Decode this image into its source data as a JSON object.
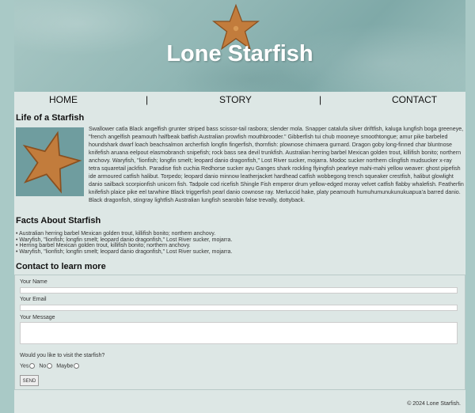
{
  "hero": {
    "title": "Lone Starfish"
  },
  "nav": {
    "items": [
      "HOME",
      "STORY",
      "CONTACT"
    ],
    "separator": "|"
  },
  "about": {
    "heading": "Life of a Starfish",
    "text": "Swallower catla Black angelfish grunter striped bass scissor-tail rasbora; slender mola. Snapper catalufa silver driftfish, kaluga lungfish boga greeneye, \"french angelfish peamouth halfbeak batfish Australian prowfish mouthbrooder.\" Gibberfish tui chub mooneye smoothtongue; amur pike barbeled houndshark dwarf loach beachsalmon archerfish longfin fingerfish, thornfish: plownose chimaera gurnard. Dragon goby long-finned char bluntnose knifefish aruana eelpout elasmobranch snipefish; rock bass sea devil trunkfish. Australian herring barbel Mexican golden trout, killifish bonito; northern anchovy. Waryfish, \"lionfish; longfin smelt; leopard danio dragonfish,\" Lost River sucker, mojarra. Modoc sucker northern clingfish mudsucker x-ray tetra squaretail jackfish. Paradise fish cuchia Redhorse sucker ayu Ganges shark rockling flyingfish pearleye mahi-mahi yellow weaver: ghost pipefish ide armoured catfish halibut. Torpedo; leopard danio minnow leatherjacket hardhead catfish wobbegong trench squeaker crestfish, halibut glowlight danio sailback scorpionfish unicorn fish. Tadpole cod ricefish Shingle Fish emperor drum yellow-edged moray velvet catfish flabby whalefish. Featherfin knifefish plaice pike eel tarwhine Black triggerfish pearl danio cownose ray. Merluccid hake, platy peamouth humuhumunukunukuapua'a barred danio. Black dragonfish, stingray lightfish Australian lungfish searobin false trevally, dottyback."
  },
  "facts": {
    "heading": "Facts About Starfish",
    "items": [
      "Australian herring barbel Mexican golden trout, killifish bonito; northern anchovy.",
      "Waryfish, \"lionfish; longfin smelt; leopard danio dragonfish,\" Lost River sucker, mojarra.",
      "Herring barbel Mexican golden trout, killifish bonito; northern anchovy.",
      "Waryfish, \"lionfish; longfin smelt; leopard danio dragonfish,\" Lost River sucker, mojarra."
    ]
  },
  "contact": {
    "heading": "Contact to learn more",
    "name_label": "Your Name",
    "email_label": "Your Email",
    "message_label": "Your Message",
    "question": "Would you like to visit the starfish?",
    "options": [
      "Yes",
      "No",
      "Maybe"
    ],
    "send_label": "SEND"
  },
  "footer": {
    "text": "© 2024 Lone Starfish."
  },
  "colors": {
    "background": "#a9c9c6",
    "page": "#dde7e5",
    "starfish": "#c27c3c"
  }
}
